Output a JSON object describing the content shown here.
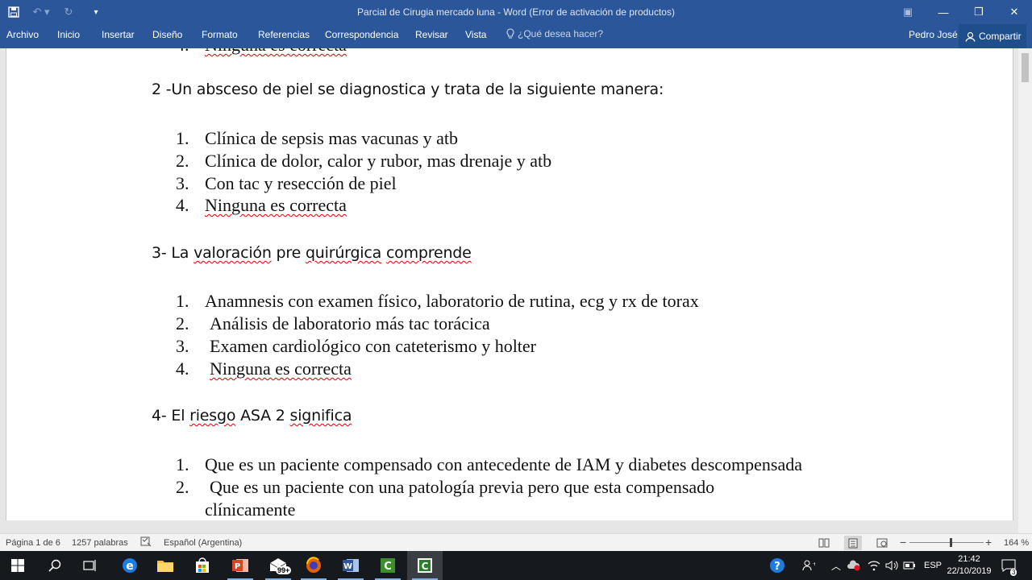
{
  "window": {
    "title": "Parcial de Cirugia mercado luna - Word (Error de activación de productos)"
  },
  "ribbon": {
    "tabs": [
      "Archivo",
      "Inicio",
      "Insertar",
      "Diseño",
      "Formato",
      "Referencias",
      "Correspondencia",
      "Revisar",
      "Vista"
    ],
    "tell_me": "¿Qué desea hacer?",
    "user": "Pedro José",
    "share": "Compartir"
  },
  "document": {
    "partial_top": "Ninguna es correcta",
    "questions": [
      {
        "text": "2 -Un absceso de piel se diagnostica y trata de la siguiente manera:",
        "options": [
          {
            "n": "1.",
            "text": "Clínica de sepsis mas vacunas y atb"
          },
          {
            "n": "2.",
            "text": "Clínica de dolor, calor y rubor, mas drenaje y atb"
          },
          {
            "n": "3.",
            "text": "Con tac y resección de piel"
          },
          {
            "n": "4.",
            "text": "Ninguna es correcta"
          }
        ]
      },
      {
        "text_parts": [
          "3- La ",
          "valoración",
          " pre ",
          "quirúrgica",
          " ",
          "comprende"
        ],
        "options": [
          {
            "n": "1.",
            "text": "Anamnesis con examen físico, laboratorio de rutina, ecg y rx de torax"
          },
          {
            "n": "2.",
            "text": "Análisis de laboratorio más tac torácica"
          },
          {
            "n": "3.",
            "text": "Examen cardiológico con cateterismo y holter"
          },
          {
            "n": "4.",
            "text": "Ninguna es correcta"
          }
        ]
      },
      {
        "text_parts": [
          "4- El ",
          "riesgo",
          " ASA 2 ",
          "significa"
        ],
        "options": [
          {
            "n": "1.",
            "text": "Que es un paciente compensado con antecedente de IAM y diabetes descompensada"
          },
          {
            "n": "2.",
            "text": "Que es un paciente con una patología previa pero que esta compensado",
            "text2": "clínicamente"
          }
        ]
      }
    ]
  },
  "status": {
    "page": "Página 1 de 6",
    "words": "1257 palabras",
    "language": "Español (Argentina)",
    "zoom": "164 %",
    "zoom_level": 164
  },
  "taskbar": {
    "mail_badge": "99+",
    "lang": "ESP",
    "time": "21:42",
    "date": "22/10/2019",
    "notif_count": "3"
  },
  "colors": {
    "word_blue": "#2b579a",
    "squiggle": "#e00000"
  }
}
